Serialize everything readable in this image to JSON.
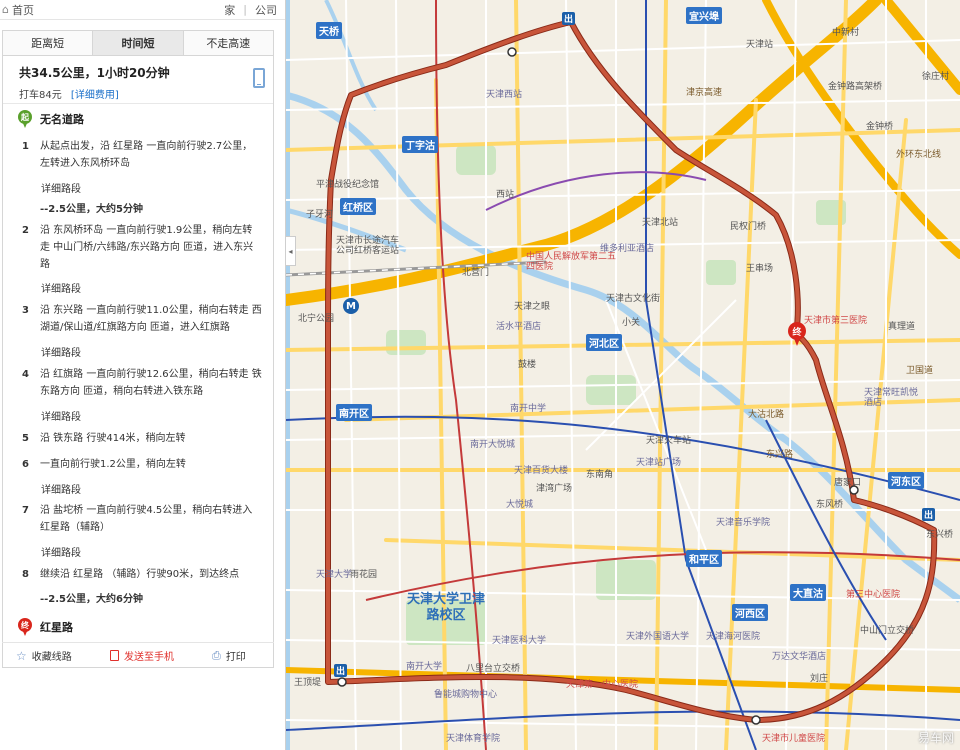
{
  "topbar": {
    "home": "首页",
    "links": [
      "家",
      "公司"
    ]
  },
  "tabs": [
    {
      "label": "距离短",
      "active": false
    },
    {
      "label": "时间短",
      "active": true
    },
    {
      "label": "不走高速",
      "active": false
    }
  ],
  "summary": {
    "main": "共34.5公里，1小时20分钟",
    "taxi": "打车84元",
    "fee_link": "[详细费用]"
  },
  "start": {
    "pin": "起",
    "label": "无名道路",
    "color": "#5aa02c"
  },
  "end": {
    "pin": "终",
    "label": "红星路",
    "color": "#d9261c"
  },
  "detail_link": "详细路段",
  "steps": [
    {
      "num": "1",
      "text": "从起点出发，沿 红星路 一直向前行驶2.7公里，左转进入东风桥环岛"
    },
    {
      "num": "2",
      "text": "沿 东风桥环岛 一直向前行驶1.9公里，稍向左转走 中山门桥/六纬路/东兴路方向 匝道，进入东兴路"
    },
    {
      "num": "3",
      "text": "沿 东兴路 一直向前行驶11.0公里，稍向右转走 西湖道/保山道/红旗路方向 匝道，进入红旗路"
    },
    {
      "num": "4",
      "text": "沿 红旗路 一直向前行驶12.6公里，稍向右转走 铁东路方向 匝道，稍向右转进入铁东路"
    },
    {
      "num": "5",
      "text": "沿 铁东路 行驶414米，稍向左转"
    },
    {
      "num": "6",
      "text": "一直向前行驶1.2公里，稍向左转"
    },
    {
      "num": "7",
      "text": "沿 盐坨桥 一直向前行驶4.5公里，稍向右转进入红星路（辅路）"
    },
    {
      "num": "8",
      "text": "继续沿 红星路 （辅路）行驶90米，到达终点"
    }
  ],
  "subtotals": [
    "--2.5公里，大约5分钟",
    "--2.5公里，大约6分钟"
  ],
  "actions": {
    "fav": "收藏线路",
    "send": "发送至手机",
    "print": "打印"
  },
  "collapse": "◂",
  "map": {
    "districts": [
      "天桥",
      "红桥区",
      "河北区",
      "南开区",
      "河东区",
      "和平区",
      "河西区",
      "丁字沽",
      "大直沽",
      "宜兴埠",
      "北辰区"
    ],
    "big_district": "天津大学卫津路校区",
    "markers": {
      "out": "出",
      "end": "终"
    },
    "labels": [
      "中新村",
      "徐庄村",
      "金钟路高架桥",
      "金钟桥",
      "外环东北线",
      "民权门桥",
      "王串场",
      "天津市第三医院",
      "真理道",
      "卫国道",
      "天津常旺凯悦酒店",
      "唐家口",
      "东风桥",
      "东兴桥",
      "天津音乐学院",
      "第三中心医院",
      "中山门立交桥",
      "万达文华酒店",
      "刘庄",
      "天津海河医院",
      "天津火车站",
      "津湾广场",
      "大沽北路",
      "天津古文化街",
      "天津北站",
      "天津站",
      "中国人民解放军第二五四医院",
      "维多利亚酒店",
      "天津之眼",
      "活水平酒店",
      "鼓楼",
      "天津百货大楼",
      "南开大悦城",
      "天津外国语大学",
      "天津医科大学",
      "南开大学",
      "天津大学",
      "八里台立交桥",
      "鲁能城购物中心",
      "天津第一中心医院",
      "天津市儿童医院",
      "天津体育学院",
      "王顶堤",
      "宜兴埠",
      "北宁公园",
      "小关",
      "东兴路",
      "雨花园",
      "津京高速",
      "天津市长途汽车公司红桥客运站",
      "子牙河",
      "平津战役纪念馆",
      "北营门",
      "西站",
      "天津西站",
      "大悦城",
      "东南角",
      "南开中学",
      "天津站广场",
      "海河"
    ],
    "watermark": "易车网"
  },
  "colors": {
    "route": "#c8553a",
    "route_outline": "#8a2a18",
    "metro": "#2a4fb0",
    "water": "#a9d1ee",
    "green": "#cde6c2",
    "highway": "#f7b400",
    "arterial": "#ffd86a"
  }
}
